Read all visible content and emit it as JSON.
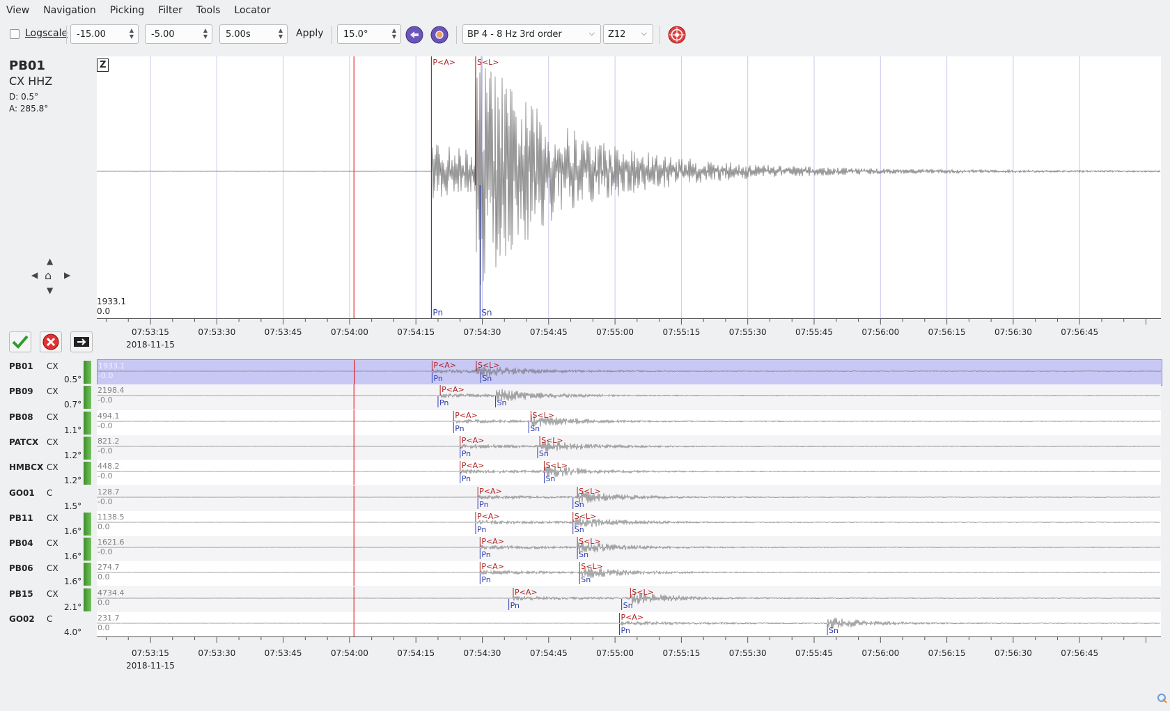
{
  "menubar": [
    "View",
    "Navigation",
    "Picking",
    "Filter",
    "Tools",
    "Locator"
  ],
  "toolbar": {
    "logscale_label": "Logscale",
    "logscale_checked": false,
    "spin1": "-15.00",
    "spin2": "-5.00",
    "spin3": "5.00s",
    "apply_label": "Apply",
    "spin4": "15.0°",
    "filter_value": "BP 4 - 8 Hz  3rd order",
    "component_value": "Z12"
  },
  "main_trace": {
    "station": "PB01",
    "channel": "CX  HHZ",
    "distance": "D:  0.5°",
    "azimuth": "A:  285.8°",
    "component_label": "Z",
    "amp_max": "1933.1",
    "amp_min": "0.0",
    "picks_top": [
      {
        "label": "P<A>",
        "t": 18.5
      },
      {
        "label": "S<L>",
        "t": 28.5
      }
    ],
    "picks_bottom": [
      {
        "label": "Pn",
        "t": 18.5
      },
      {
        "label": "Sn",
        "t": 29.5
      }
    ]
  },
  "time_axis": {
    "labels": [
      "07:53:15",
      "07:53:30",
      "07:53:45",
      "07:54:00",
      "07:54:15",
      "07:54:30",
      "07:54:45",
      "07:55:00",
      "07:55:15",
      "07:55:30",
      "07:55:45",
      "07:56:00",
      "07:56:15",
      "07:56:30",
      "07:56:45"
    ],
    "date": "2018-11-15",
    "ref_time_label": "07:54:00"
  },
  "stations": [
    {
      "name": "PB01",
      "net": "CX",
      "dist": "0.5°",
      "amp": "1933.1",
      "amp2": "-0.0",
      "p": 18.5,
      "s": 28.5,
      "pn": 18.5,
      "sn": 29.5,
      "bar": true,
      "selected": true
    },
    {
      "name": "PB09",
      "net": "CX",
      "dist": "0.7°",
      "amp": "2198.4",
      "amp2": "-0.0",
      "p": 20.5,
      "s": null,
      "pn": 20.0,
      "sn": 33.0,
      "bar": true,
      "selected": false
    },
    {
      "name": "PB08",
      "net": "CX",
      "dist": "1.1°",
      "amp": "494.1",
      "amp2": "-0.0",
      "p": 23.5,
      "s": 41.0,
      "pn": 23.5,
      "sn": 40.5,
      "bar": true,
      "selected": false
    },
    {
      "name": "PATCX",
      "net": "CX",
      "dist": "1.2°",
      "amp": "821.2",
      "amp2": "-0.0",
      "p": 25.0,
      "s": 43.0,
      "pn": 25.0,
      "sn": 42.5,
      "bar": true,
      "selected": false
    },
    {
      "name": "HMBCX",
      "net": "CX",
      "dist": "1.2°",
      "amp": "448.2",
      "amp2": "-0.0",
      "p": 25.0,
      "s": 44.0,
      "pn": 25.0,
      "sn": 44.0,
      "bar": true,
      "selected": false
    },
    {
      "name": "GO01",
      "net": "C",
      "dist": "1.5°",
      "amp": "128.7",
      "amp2": "-0.0",
      "p": 29.0,
      "s": 51.5,
      "pn": 29.0,
      "sn": 50.5,
      "bar": false,
      "selected": false
    },
    {
      "name": "PB11",
      "net": "CX",
      "dist": "1.6°",
      "amp": "1138.5",
      "amp2": "0.0",
      "p": 28.5,
      "s": 50.5,
      "pn": 28.5,
      "sn": 50.5,
      "bar": true,
      "selected": false
    },
    {
      "name": "PB04",
      "net": "CX",
      "dist": "1.6°",
      "amp": "1621.6",
      "amp2": "-0.0",
      "p": 29.5,
      "s": 51.5,
      "pn": 29.5,
      "sn": 51.5,
      "bar": true,
      "selected": false
    },
    {
      "name": "PB06",
      "net": "CX",
      "dist": "1.6°",
      "amp": "274.7",
      "amp2": "0.0",
      "p": 29.5,
      "s": 52.0,
      "pn": 29.5,
      "sn": 52.0,
      "bar": true,
      "selected": false
    },
    {
      "name": "PB15",
      "net": "CX",
      "dist": "2.1°",
      "amp": "4734.4",
      "amp2": "0.0",
      "p": 37.0,
      "s": 63.5,
      "pn": 36.0,
      "sn": 61.5,
      "bar": true,
      "selected": false
    },
    {
      "name": "GO02",
      "net": "C",
      "dist": "4.0°",
      "amp": "231.7",
      "amp2": "0.0",
      "p": 61.0,
      "s": null,
      "pn": 61.0,
      "sn": 108.0,
      "bar": false,
      "selected": false
    }
  ],
  "colors": {
    "pick": "#b22222",
    "pick_auto": "#2c3cb0",
    "reference": "#e02020",
    "selection": "#c8c8f5",
    "trace": "#6e6e6e",
    "grid": "#c8c8ee"
  }
}
